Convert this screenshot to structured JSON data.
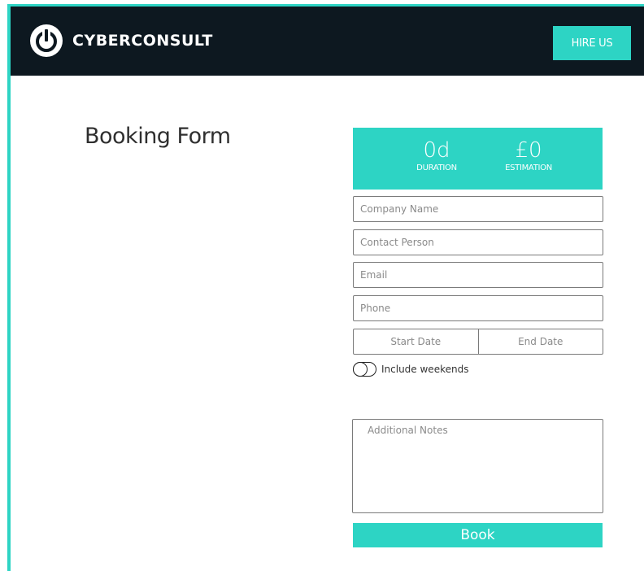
{
  "header": {
    "brand": "CYBERCONSULT",
    "logo_icon": "power-icon",
    "hire_label": "HIRE US"
  },
  "page": {
    "title": "Booking Form"
  },
  "summary": {
    "duration_value": "0d",
    "duration_label": "DURATION",
    "estimation_value": "£0",
    "estimation_label": "ESTIMATION"
  },
  "form": {
    "company_placeholder": "Company Name",
    "contact_placeholder": "Contact Person",
    "email_placeholder": "Email",
    "phone_placeholder": "Phone",
    "start_date_label": "Start Date",
    "end_date_label": "End Date",
    "weekends_label": "Include weekends",
    "weekends_on": false,
    "notes_placeholder": "Additional Notes",
    "book_label": "Book"
  },
  "colors": {
    "accent": "#2dd4c4",
    "header_bg": "#0d1820"
  }
}
